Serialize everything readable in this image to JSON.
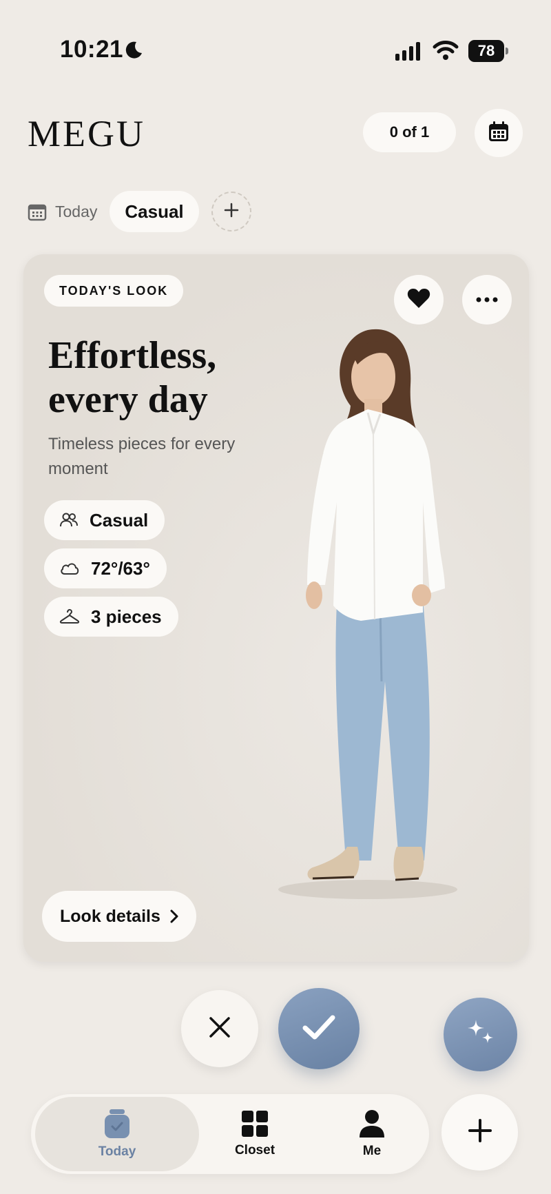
{
  "status_bar": {
    "time": "10:21",
    "battery": "78"
  },
  "header": {
    "brand": "MEGU",
    "counter": "0 of 1"
  },
  "filters": {
    "today_label": "Today",
    "active_chip": "Casual"
  },
  "look_card": {
    "badge": "TODAY'S LOOK",
    "headline": "Effortless, every day",
    "subtitle": "Timeless pieces for every moment",
    "pills": {
      "style": "Casual",
      "weather": "72°/63°",
      "pieces": "3 pieces"
    },
    "details_button": "Look details"
  },
  "tab_bar": {
    "today": "Today",
    "closet": "Closet",
    "me": "Me"
  },
  "colors": {
    "accent": "#7890b0",
    "background": "#efebe6",
    "surface": "#fbf9f6"
  },
  "icons": [
    "moon-icon",
    "signal-icon",
    "wifi-icon",
    "calendar-icon",
    "plus-icon",
    "heart-icon",
    "more-icon",
    "people-icon",
    "cloud-icon",
    "hanger-icon",
    "chevron-right-icon",
    "close-icon",
    "check-icon",
    "sparkle-icon",
    "jar-icon",
    "grid-icon",
    "person-icon"
  ]
}
